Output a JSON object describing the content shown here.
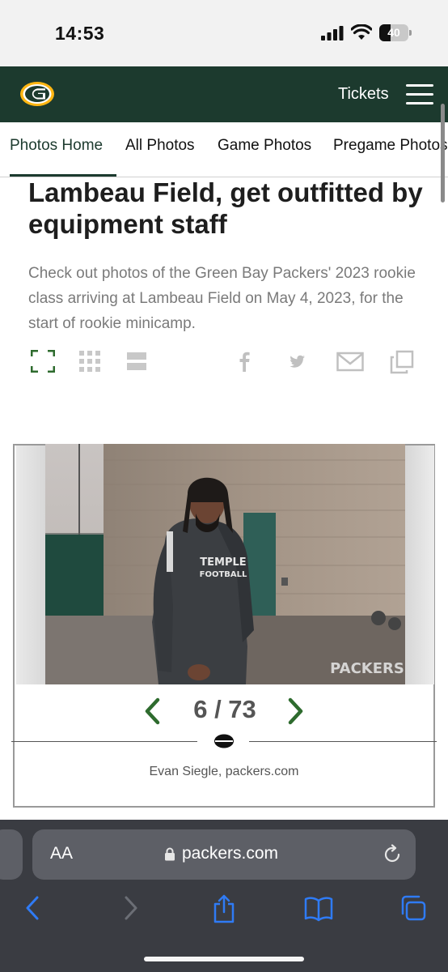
{
  "status_bar": {
    "time": "14:53",
    "battery": "40",
    "battery_level": 0.4
  },
  "header": {
    "tickets_label": "Tickets",
    "logo_icon": "packers-g-logo",
    "menu_icon": "hamburger-menu-icon",
    "brand_color": "#1c3a2e"
  },
  "nav": {
    "tabs": [
      {
        "label": "Photos Home",
        "active": true
      },
      {
        "label": "All Photos"
      },
      {
        "label": "Game Photos"
      },
      {
        "label": "Pregame Photos"
      }
    ]
  },
  "article": {
    "headline": "Lambeau Field, get outfitted by equipment staff",
    "description": "Check out photos of the Green Bay Packers' 2023 rookie class arriving at Lambeau Field on May 4, 2023, for the start of rookie minicamp.",
    "tool_icons": [
      "fullscreen-icon",
      "grid-view-icon",
      "list-view-icon",
      "facebook-icon",
      "twitter-icon",
      "email-icon",
      "copy-link-icon"
    ]
  },
  "gallery": {
    "counter": "6 / 73",
    "caption": "Evan Siegle, packers.com",
    "watermark": "PACKERS",
    "shirt_text": "TEMPLE FOOTBALL"
  },
  "browser": {
    "text_size_label": "AA",
    "url": "packers.com",
    "toolbar_icons": [
      "back-icon",
      "forward-icon",
      "share-icon",
      "bookmarks-icon",
      "tabs-icon"
    ]
  }
}
